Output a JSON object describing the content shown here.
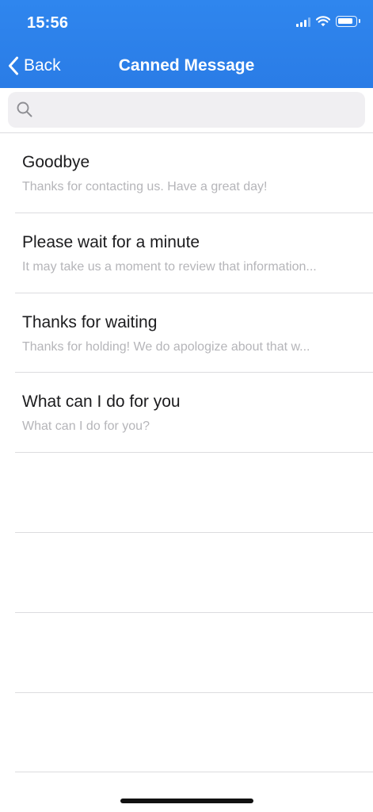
{
  "status_bar": {
    "time": "15:56"
  },
  "nav": {
    "back_label": "Back",
    "title": "Canned Message"
  },
  "search": {
    "placeholder": "",
    "value": ""
  },
  "messages": [
    {
      "title": "Goodbye",
      "preview": "Thanks for contacting us. Have a great day!"
    },
    {
      "title": "Please wait for a minute",
      "preview": "It may take us a moment to review that information..."
    },
    {
      "title": "Thanks for waiting",
      "preview": "Thanks for holding! We do apologize about that w..."
    },
    {
      "title": "What can I do for you",
      "preview": "What can I do for you?"
    }
  ],
  "colors": {
    "header": "#2f86ee",
    "search_bg": "#f0eff2",
    "separator": "#dcdcdf",
    "subtitle": "#b5b5b9"
  }
}
